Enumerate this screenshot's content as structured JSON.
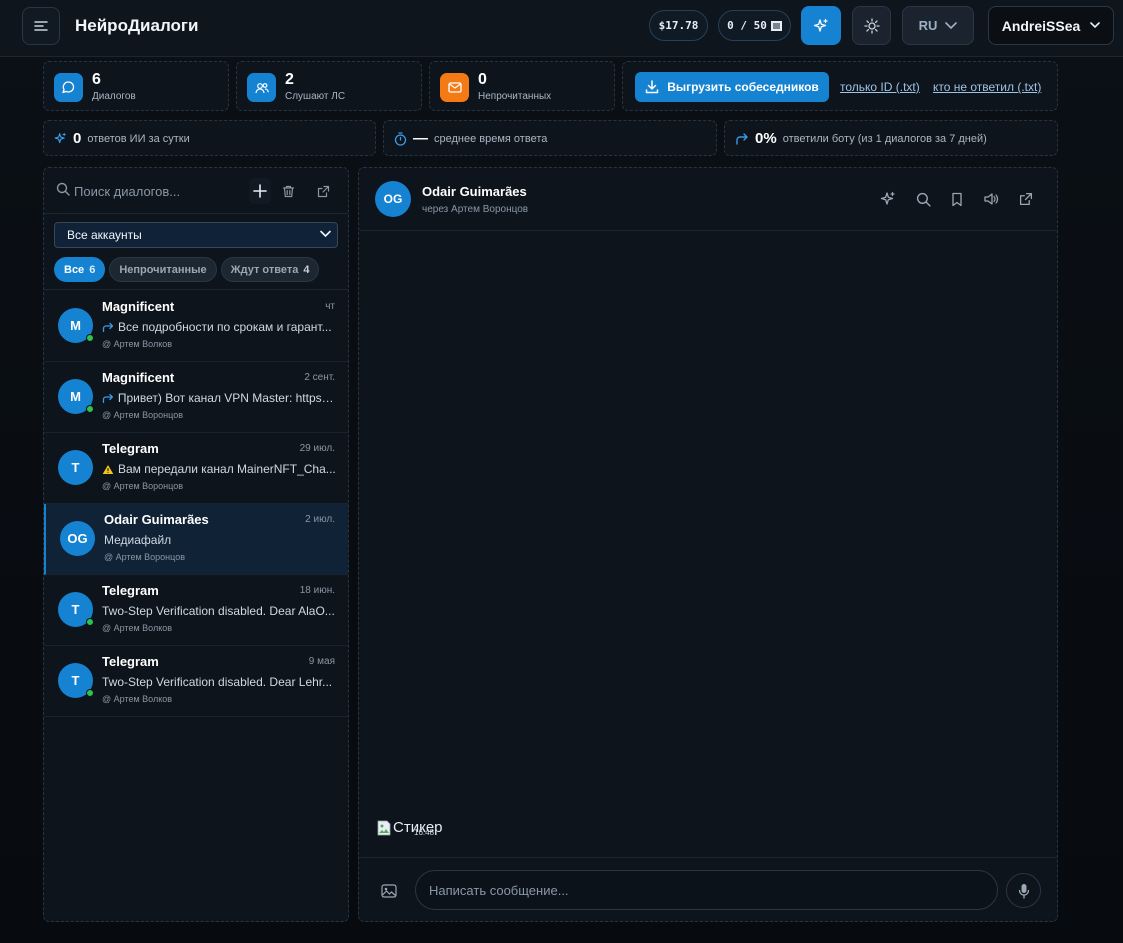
{
  "header": {
    "title": "НейроДиалоги",
    "balance": "$17.78",
    "quota": "0 / 50",
    "language": "RU",
    "user": "AndreiSSea"
  },
  "stats": {
    "dialogs": {
      "value": "6",
      "label": "Диалогов"
    },
    "listening": {
      "value": "2",
      "label": "Слушают ЛС"
    },
    "unread": {
      "value": "0",
      "label": "Непрочитанных"
    },
    "export_label": "Выгрузить собеседников",
    "export_ids": "только ID (.txt)",
    "export_unanswered": "кто не ответил (.txt)"
  },
  "metrics": {
    "ai_replies": {
      "value": "0",
      "label": "ответов ИИ за сутки"
    },
    "avg_time": {
      "value": "—",
      "label": "среднее время ответа"
    },
    "bot_reply": {
      "value": "0%",
      "label": "ответили боту (из 1 диалогов за 7 дней)"
    }
  },
  "sidebar": {
    "search_placeholder": "Поиск диалогов...",
    "account_select": "Все аккаунты",
    "filters": [
      {
        "label": "Все",
        "count": "6",
        "active": true
      },
      {
        "label": "Непрочитанные",
        "count": "",
        "active": false
      },
      {
        "label": "Ждут ответа",
        "count": "4",
        "active": false
      }
    ],
    "dialogs": [
      {
        "initials": "M",
        "name": "Magnificent",
        "date": "чт",
        "preview": "Все подробности по срокам и гарант...",
        "icon": "forward",
        "account": "Артем Волков",
        "online": true,
        "active": false
      },
      {
        "initials": "M",
        "name": "Magnificent",
        "date": "2 сент.",
        "preview": "Привет) Вот канал VPN Master: https:/...",
        "icon": "forward",
        "account": "Артем Воронцов",
        "online": true,
        "active": false
      },
      {
        "initials": "T",
        "name": "Telegram",
        "date": "29 июл.",
        "preview": "Вам передали канал MainerNFT_Cha...",
        "icon": "warning",
        "account": "Артем Воронцов",
        "online": false,
        "active": false
      },
      {
        "initials": "OG",
        "name": "Odair Guimarães",
        "date": "2 июл.",
        "preview": "Медиафайл",
        "icon": "",
        "account": "Артем Воронцов",
        "online": false,
        "active": true
      },
      {
        "initials": "T",
        "name": "Telegram",
        "date": "18 июн.",
        "preview": "Two-Step Verification disabled. Dear AlaO...",
        "icon": "",
        "account": "Артем Волков",
        "online": true,
        "active": false
      },
      {
        "initials": "T",
        "name": "Telegram",
        "date": "9 мая",
        "preview": "Two-Step Verification disabled. Dear Lehr...",
        "icon": "",
        "account": "Артем Волков",
        "online": true,
        "active": false
      }
    ]
  },
  "chat": {
    "initials": "OG",
    "name": "Odair Guimarães",
    "via": "через Артем Воронцов",
    "sticker_alt": "Стикер",
    "sticker_time": "16:48",
    "input_placeholder": "Написать сообщение..."
  },
  "colors": {
    "accent": "#1583d2",
    "orange": "#f47a16",
    "online": "#2bc44f",
    "warning": "#f5c518"
  }
}
